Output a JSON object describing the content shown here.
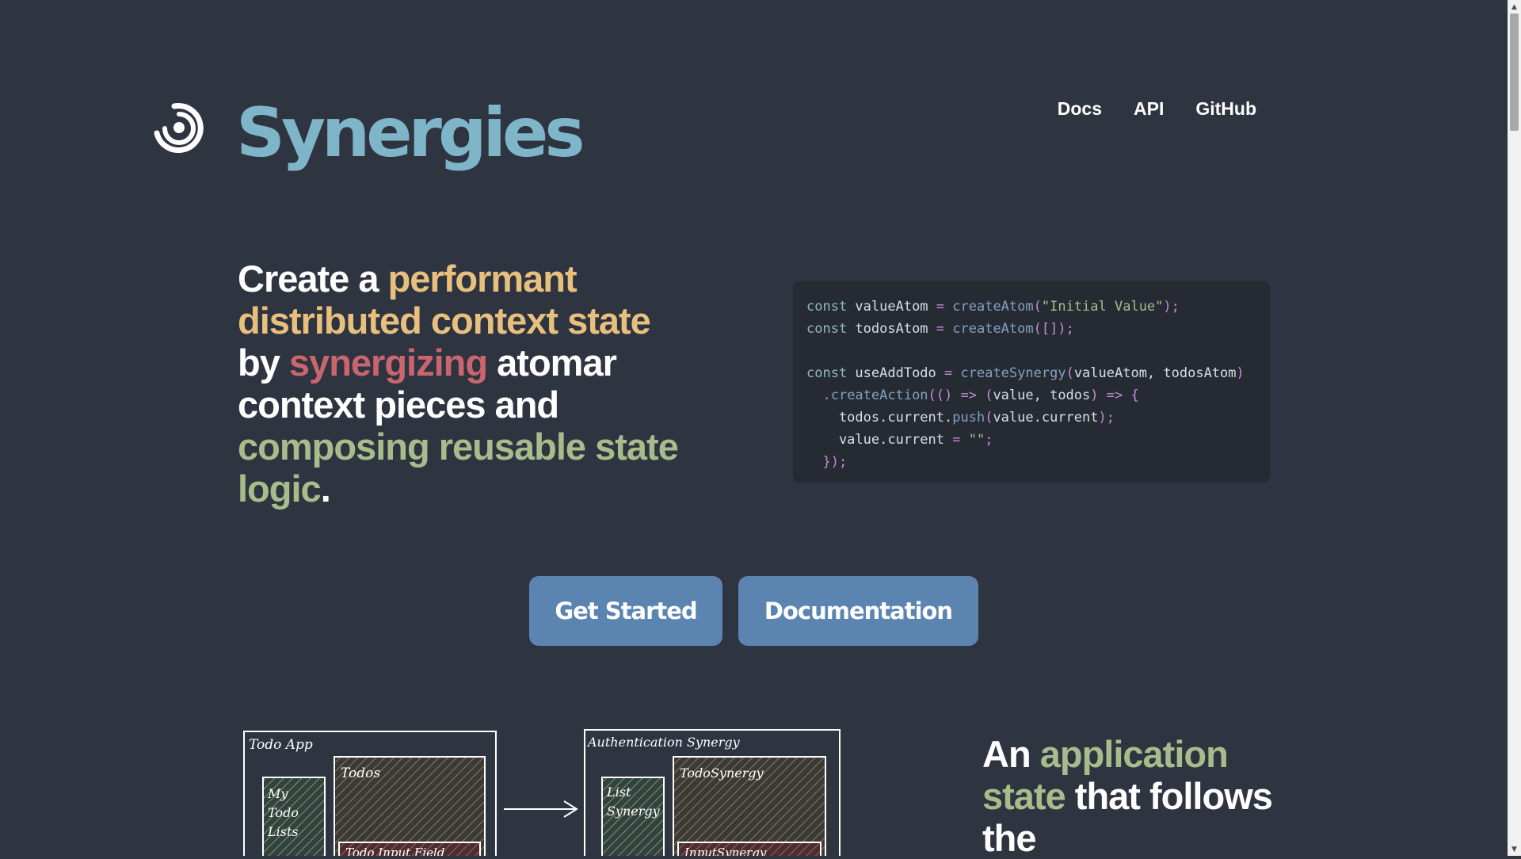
{
  "header": {
    "logo_icon": "swirl-logo-icon",
    "brand": "Synergies",
    "nav": [
      {
        "label": "Docs"
      },
      {
        "label": "API"
      },
      {
        "label": "GitHub"
      }
    ]
  },
  "hero": {
    "parts": [
      {
        "text": "Create a ",
        "color": "white"
      },
      {
        "text": "performant distributed context state",
        "color": "#e8c07d"
      },
      {
        "text": " by ",
        "color": "white"
      },
      {
        "text": "synergizing",
        "color": "#c9666d"
      },
      {
        "text": " atomar context pieces and ",
        "color": "white"
      },
      {
        "text": "composing reusable state logic",
        "color": "#a7bb8b"
      },
      {
        "text": ".",
        "color": "white"
      }
    ]
  },
  "code_lines": [
    [
      "const ",
      "valueAtom ",
      "= ",
      "createAtom",
      "(",
      "\"Initial Value\"",
      ");"
    ],
    [
      "const ",
      "todosAtom ",
      "= ",
      "createAtom",
      "([]);"
    ],
    [
      ""
    ],
    [
      "const ",
      "useAddTodo ",
      "= ",
      "createSynergy",
      "(",
      "valueAtom, todosAtom",
      ")"
    ],
    [
      "  .",
      "createAction",
      "(() => (",
      "value, todos",
      ") => {"
    ],
    [
      "    todos.current.",
      "push",
      "(",
      "value.current",
      ");"
    ],
    [
      "    value.current ",
      "= ",
      "\"\"",
      ";"
    ],
    [
      "  });"
    ]
  ],
  "buttons": {
    "get_started": "Get Started",
    "documentation": "Documentation"
  },
  "diagram": {
    "left_box": "Todo App",
    "left_side": [
      "My",
      "Todo",
      "Lists"
    ],
    "left_main": "Todos",
    "left_sub": "Todo Input Field",
    "right_box": "Authentication Synergy",
    "right_side": [
      "List",
      "Synergy"
    ],
    "right_main": "TodoSynergy",
    "right_sub": "InputSynergy"
  },
  "section": {
    "parts": [
      {
        "text": "An ",
        "color": "white"
      },
      {
        "text": "application state",
        "color": "#a7bb8b"
      },
      {
        "text": " that follows the",
        "color": "white"
      }
    ]
  }
}
